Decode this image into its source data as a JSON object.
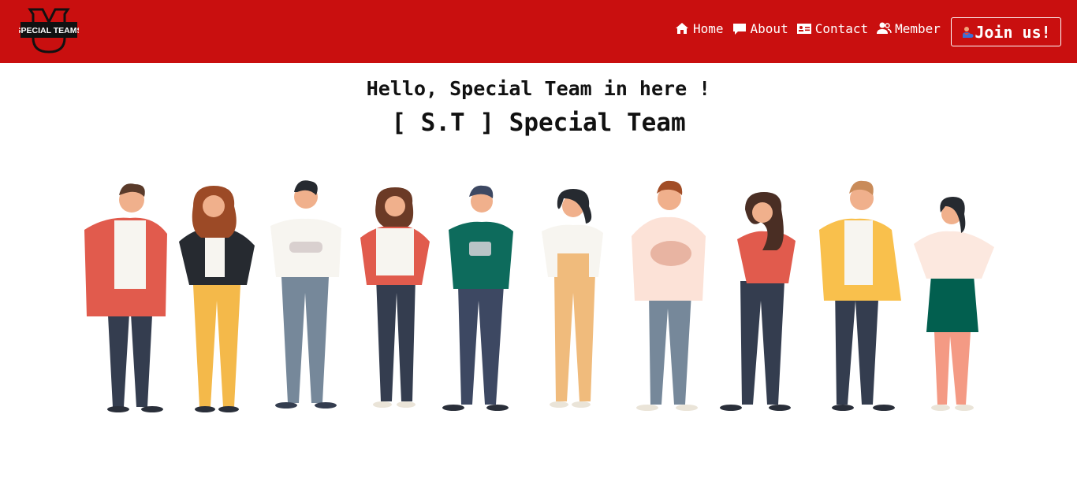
{
  "header": {
    "logo": {
      "text": "SPECIAL TEAMS",
      "icon": "special-teams-logo"
    },
    "nav": [
      {
        "label": "Home",
        "icon": "home-icon"
      },
      {
        "label": "About",
        "icon": "chat-bubble-icon"
      },
      {
        "label": "Contact",
        "icon": "contact-card-icon"
      },
      {
        "label": "Member",
        "icon": "users-icon"
      }
    ],
    "join_button": {
      "label": "Join us!",
      "icon": "person-add-icon"
    }
  },
  "hero": {
    "greeting": "Hello, Special Team in here !",
    "title": "[ S.T ] Special Team"
  },
  "colors": {
    "navbar": "#c90f0f",
    "text": "#111111",
    "background": "#ffffff"
  }
}
